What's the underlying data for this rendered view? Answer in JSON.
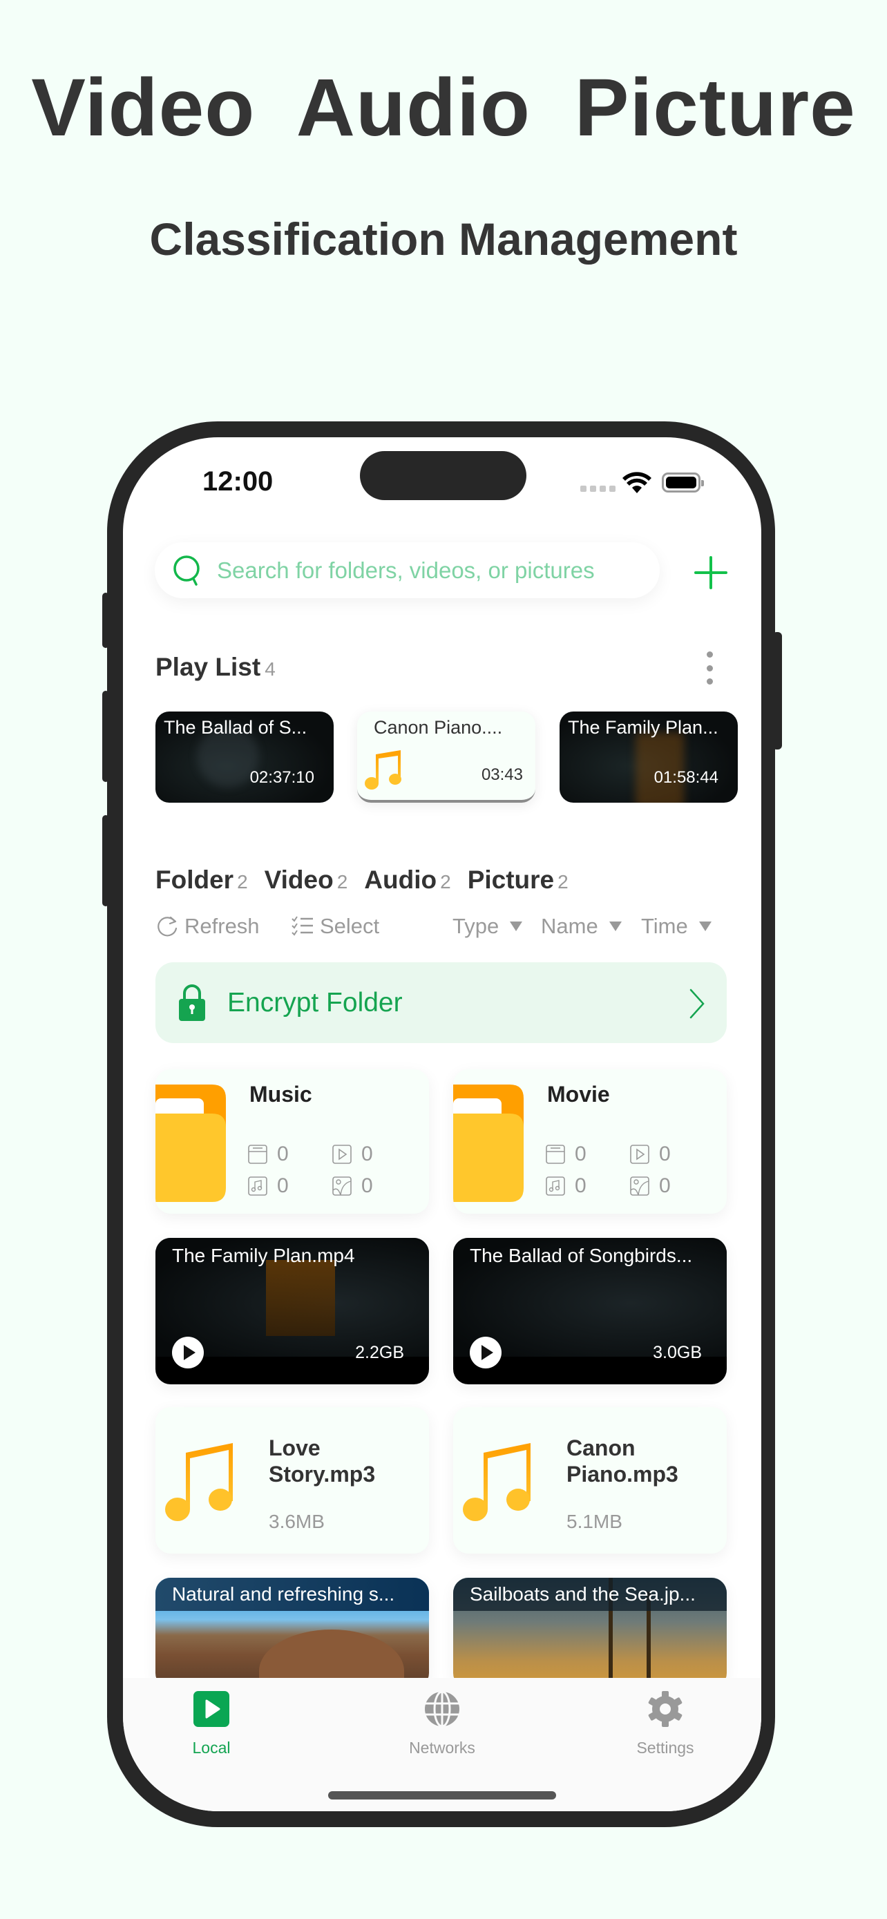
{
  "promo": {
    "headline": "Video  Audio  Picture",
    "subline": "Classification Management"
  },
  "status_bar": {
    "time": "12:00"
  },
  "search": {
    "placeholder": "Search for folders, videos, or pictures"
  },
  "colors": {
    "accent": "#15a450",
    "background": "#f4fff9",
    "folder": "#ffc72c",
    "note": "#ffb400"
  },
  "playlist": {
    "title": "Play List",
    "count": "4",
    "items": [
      {
        "title": "The Ballad of S...",
        "duration": "02:37:10",
        "kind": "video"
      },
      {
        "title": "Canon Piano....",
        "duration": "03:43",
        "kind": "audio"
      },
      {
        "title": "The Family Plan...",
        "duration": "01:58:44",
        "kind": "video"
      }
    ]
  },
  "category_tabs": [
    {
      "label": "Folder",
      "count": "2"
    },
    {
      "label": "Video",
      "count": "2"
    },
    {
      "label": "Audio",
      "count": "2"
    },
    {
      "label": "Picture",
      "count": "2"
    }
  ],
  "toolbar": {
    "refresh": "Refresh",
    "select": "Select",
    "sort_type": "Type",
    "sort_name": "Name",
    "sort_time": "Time"
  },
  "encrypt": {
    "label": "Encrypt Folder"
  },
  "folders": [
    {
      "name": "Music",
      "folders": "0",
      "videos": "0",
      "audios": "0",
      "pictures": "0"
    },
    {
      "name": "Movie",
      "folders": "0",
      "videos": "0",
      "audios": "0",
      "pictures": "0"
    }
  ],
  "videos": [
    {
      "title": "The Family Plan.mp4",
      "size": "2.2GB"
    },
    {
      "title": "The Ballad of Songbirds...",
      "size": "3.0GB"
    }
  ],
  "audios": [
    {
      "title": "Love Story.mp3",
      "size": "3.6MB"
    },
    {
      "title": "Canon Piano.mp3",
      "size": "5.1MB"
    }
  ],
  "pictures": [
    {
      "title": "Natural and refreshing s..."
    },
    {
      "title": "Sailboats and the Sea.jp..."
    }
  ],
  "tabbar": [
    {
      "label": "Local",
      "active": true
    },
    {
      "label": "Networks",
      "active": false
    },
    {
      "label": "Settings",
      "active": false
    }
  ]
}
